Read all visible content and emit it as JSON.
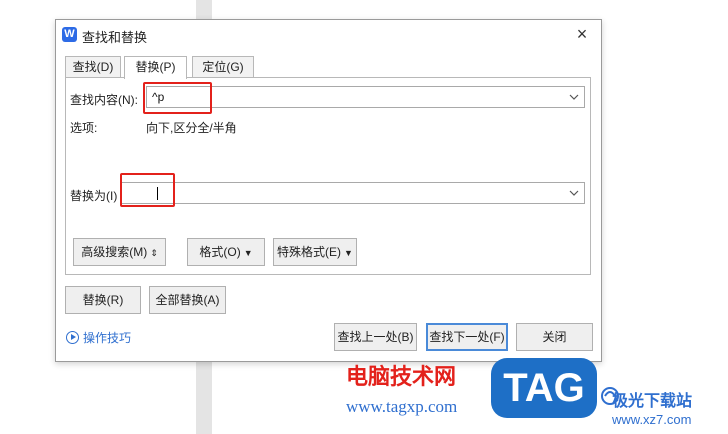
{
  "window": {
    "title": "查找和替换",
    "logo_letter": "W"
  },
  "tabs": [
    {
      "label": "查找(D)",
      "active": false
    },
    {
      "label": "替换(P)",
      "active": true
    },
    {
      "label": "定位(G)",
      "active": false
    }
  ],
  "find": {
    "label": "查找内容(N):",
    "value": "^p"
  },
  "options": {
    "label": "选项:",
    "value": "向下,区分全/半角"
  },
  "replace": {
    "label": "替换为(I)",
    "value": ""
  },
  "buttons": {
    "advanced": "高级搜索(M)",
    "format": "格式(O)",
    "special": "特殊格式(E)",
    "replace": "替换(R)",
    "replace_all": "全部替换(A)",
    "find_prev": "查找上一处(B)",
    "find_next": "查找下一处(F)",
    "close": "关闭"
  },
  "tips": "操作技巧",
  "watermark": {
    "brand": "电脑技术网",
    "url": "www.tagxp.com",
    "tag": "TAG",
    "site_name": "极光下载站",
    "site_url": "www.xz7.com"
  },
  "colors": {
    "highlight": "#e3211b",
    "accent": "#2f6fcf",
    "tag_bg": "#1e6fc6"
  }
}
